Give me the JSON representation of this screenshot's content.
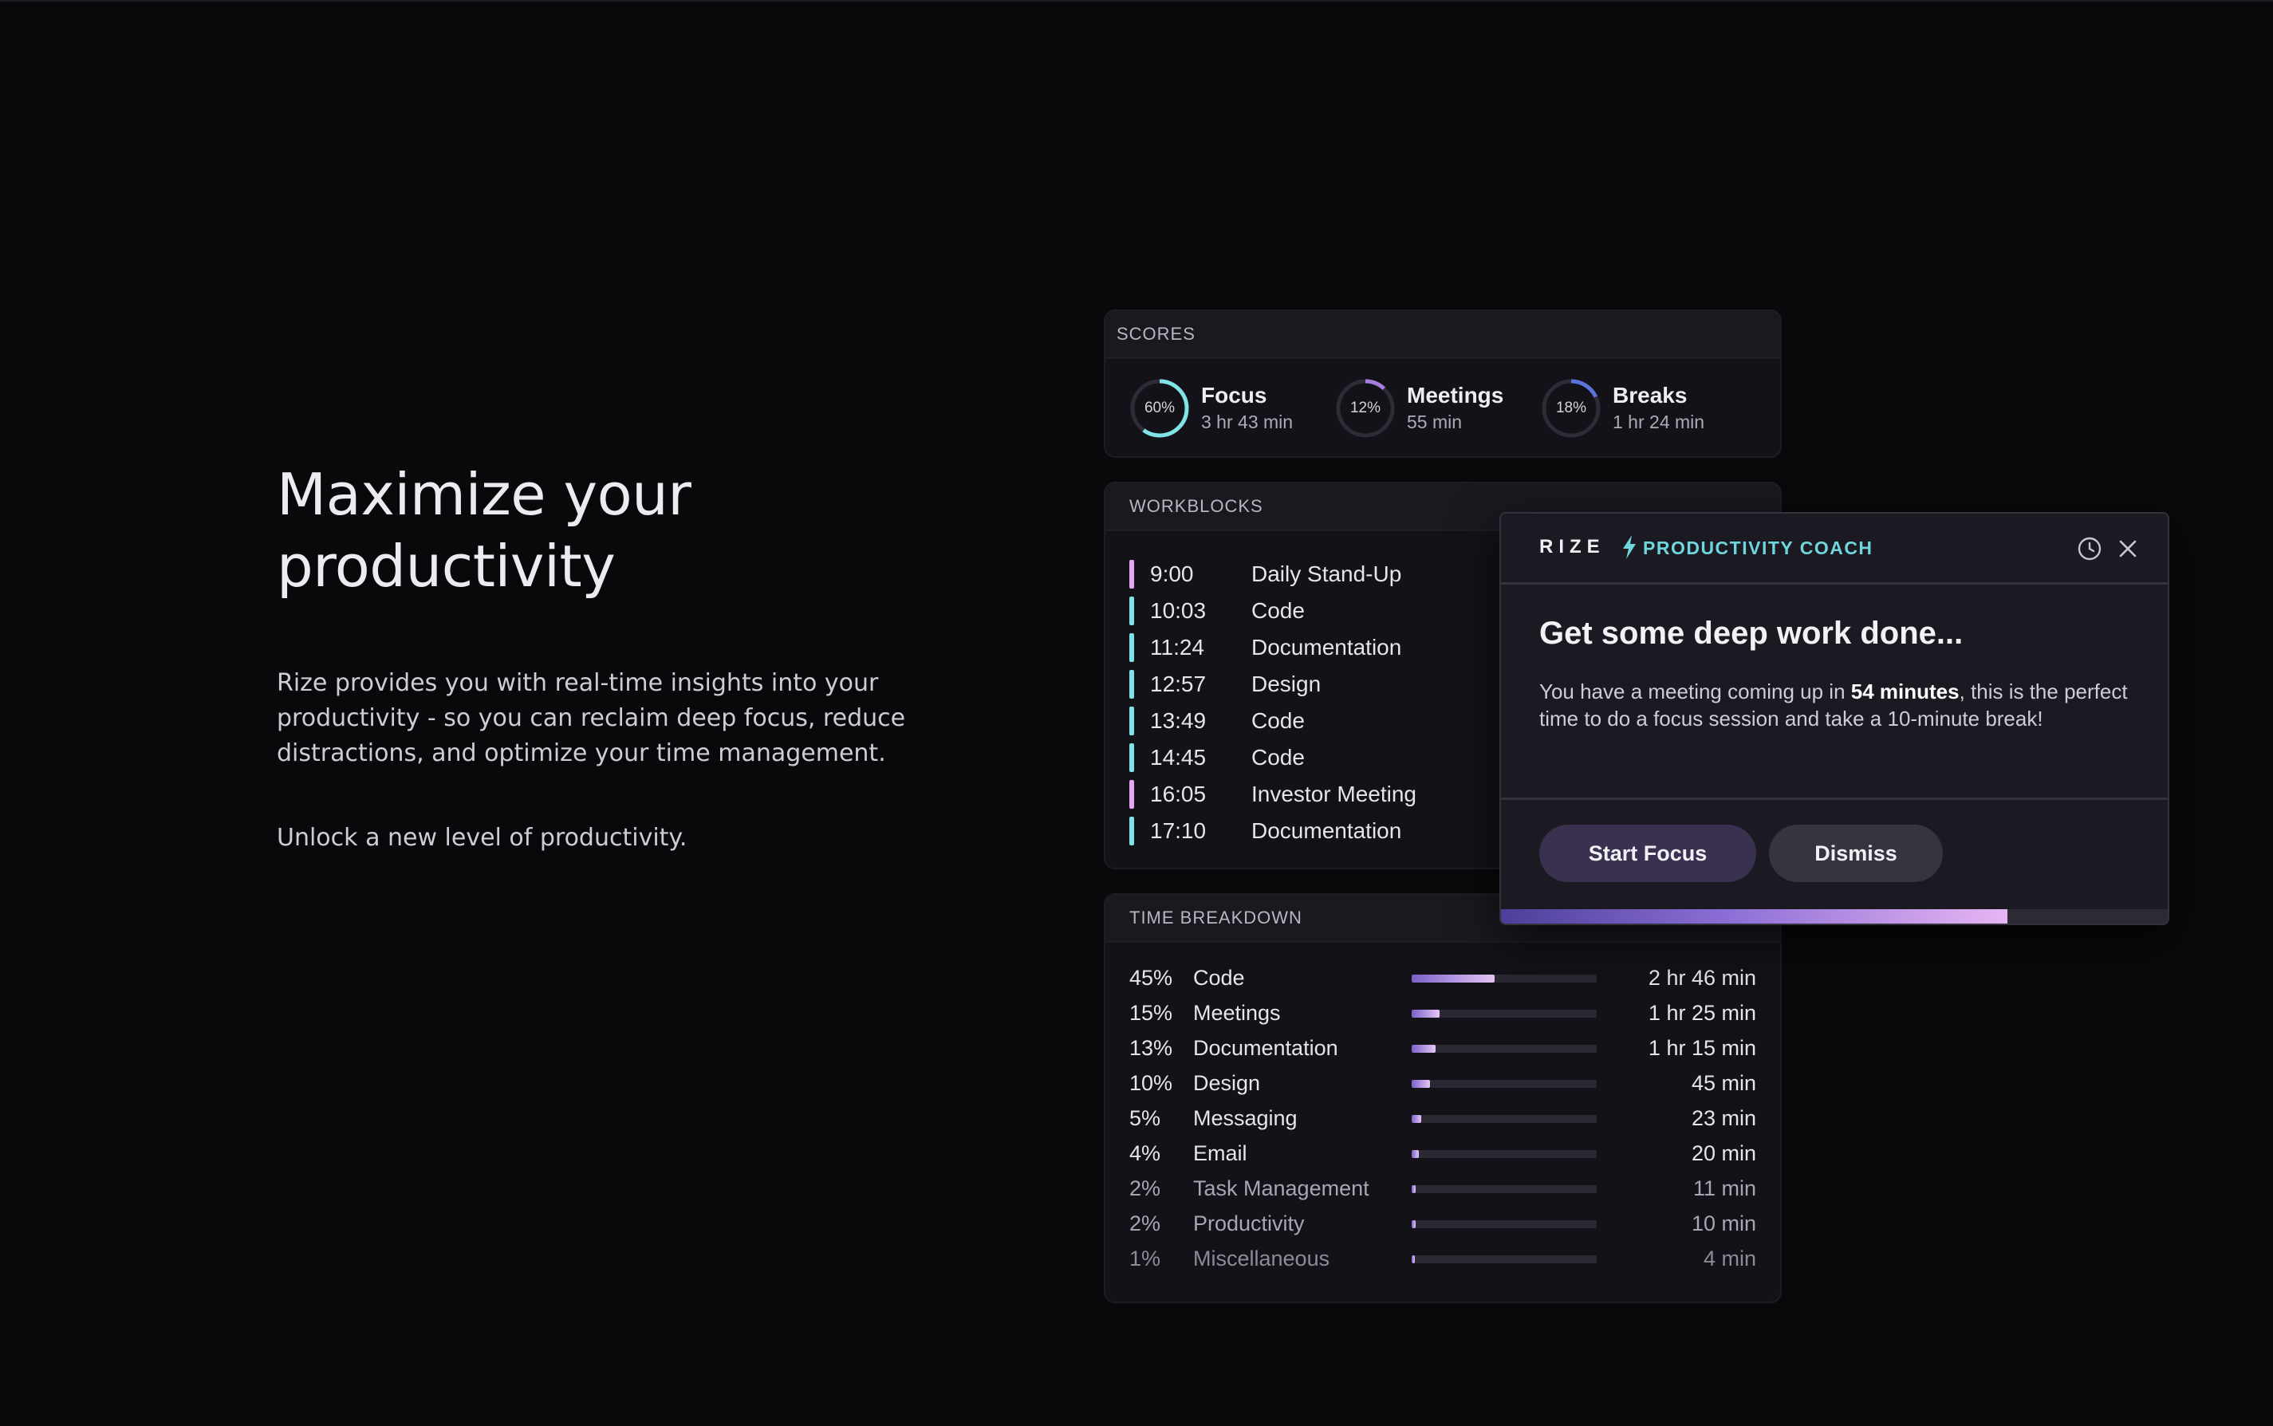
{
  "hero": {
    "title_line1": "Maximize your",
    "title_line2": "productivity",
    "description": "Rize provides you with real-time insights into your productivity - so you can reclaim deep focus, reduce distractions, and optimize your time management.",
    "cta": "Unlock a new level of productivity."
  },
  "scores": {
    "header": "SCORES",
    "items": [
      {
        "pct_label": "60%",
        "pct": 60,
        "label": "Focus",
        "sub": "3 hr 43 min",
        "color": "#7fe3e8"
      },
      {
        "pct_label": "12%",
        "pct": 12,
        "label": "Meetings",
        "sub": "55 min",
        "color": "#a77be0"
      },
      {
        "pct_label": "18%",
        "pct": 18,
        "label": "Breaks",
        "sub": "1 hr 24 min",
        "color": "#5b74dd"
      }
    ]
  },
  "workblocks": {
    "header": "WORKBLOCKS",
    "items": [
      {
        "time": "9:00",
        "title": "Daily Stand-Up",
        "color": "#e6a6f0"
      },
      {
        "time": "10:03",
        "title": "Code",
        "color": "#7fe3e8"
      },
      {
        "time": "11:24",
        "title": "Documentation",
        "color": "#7fe3e8"
      },
      {
        "time": "12:57",
        "title": "Design",
        "color": "#7fe3e8"
      },
      {
        "time": "13:49",
        "title": "Code",
        "color": "#7fe3e8"
      },
      {
        "time": "14:45",
        "title": "Code",
        "color": "#7fe3e8"
      },
      {
        "time": "16:05",
        "title": "Investor Meeting",
        "color": "#e6a6f0"
      },
      {
        "time": "17:10",
        "title": "Documentation",
        "color": "#7fe3e8"
      }
    ]
  },
  "breakdown": {
    "header": "TIME BREAKDOWN",
    "items": [
      {
        "pct_label": "45%",
        "pct": 45,
        "name": "Code",
        "duration": "2 hr 46 min"
      },
      {
        "pct_label": "15%",
        "pct": 15,
        "name": "Meetings",
        "duration": "1 hr 25 min"
      },
      {
        "pct_label": "13%",
        "pct": 13,
        "name": "Documentation",
        "duration": "1 hr 15 min"
      },
      {
        "pct_label": "10%",
        "pct": 10,
        "name": "Design",
        "duration": "45 min"
      },
      {
        "pct_label": "5%",
        "pct": 5,
        "name": "Messaging",
        "duration": "23 min"
      },
      {
        "pct_label": "4%",
        "pct": 4,
        "name": "Email",
        "duration": "20 min"
      },
      {
        "pct_label": "2%",
        "pct": 2,
        "name": "Task Management",
        "duration": "11 min"
      },
      {
        "pct_label": "2%",
        "pct": 2,
        "name": "Productivity",
        "duration": "10 min"
      },
      {
        "pct_label": "1%",
        "pct": 1,
        "name": "Miscellaneous",
        "duration": "4 min"
      }
    ]
  },
  "coach": {
    "brand": "RIZE",
    "tag": "PRODUCTIVITY COACH",
    "history_icon": "clock-icon",
    "close_icon": "close-icon",
    "title": "Get some deep work done...",
    "body_before": "You have a meeting coming up in ",
    "body_bold": "54 minutes",
    "body_after": ", this is the perfect time to do a focus session and take a 10-minute break!",
    "start_label": "Start Focus",
    "dismiss_label": "Dismiss",
    "progress": 0.76,
    "accent": "#6fd6de"
  }
}
